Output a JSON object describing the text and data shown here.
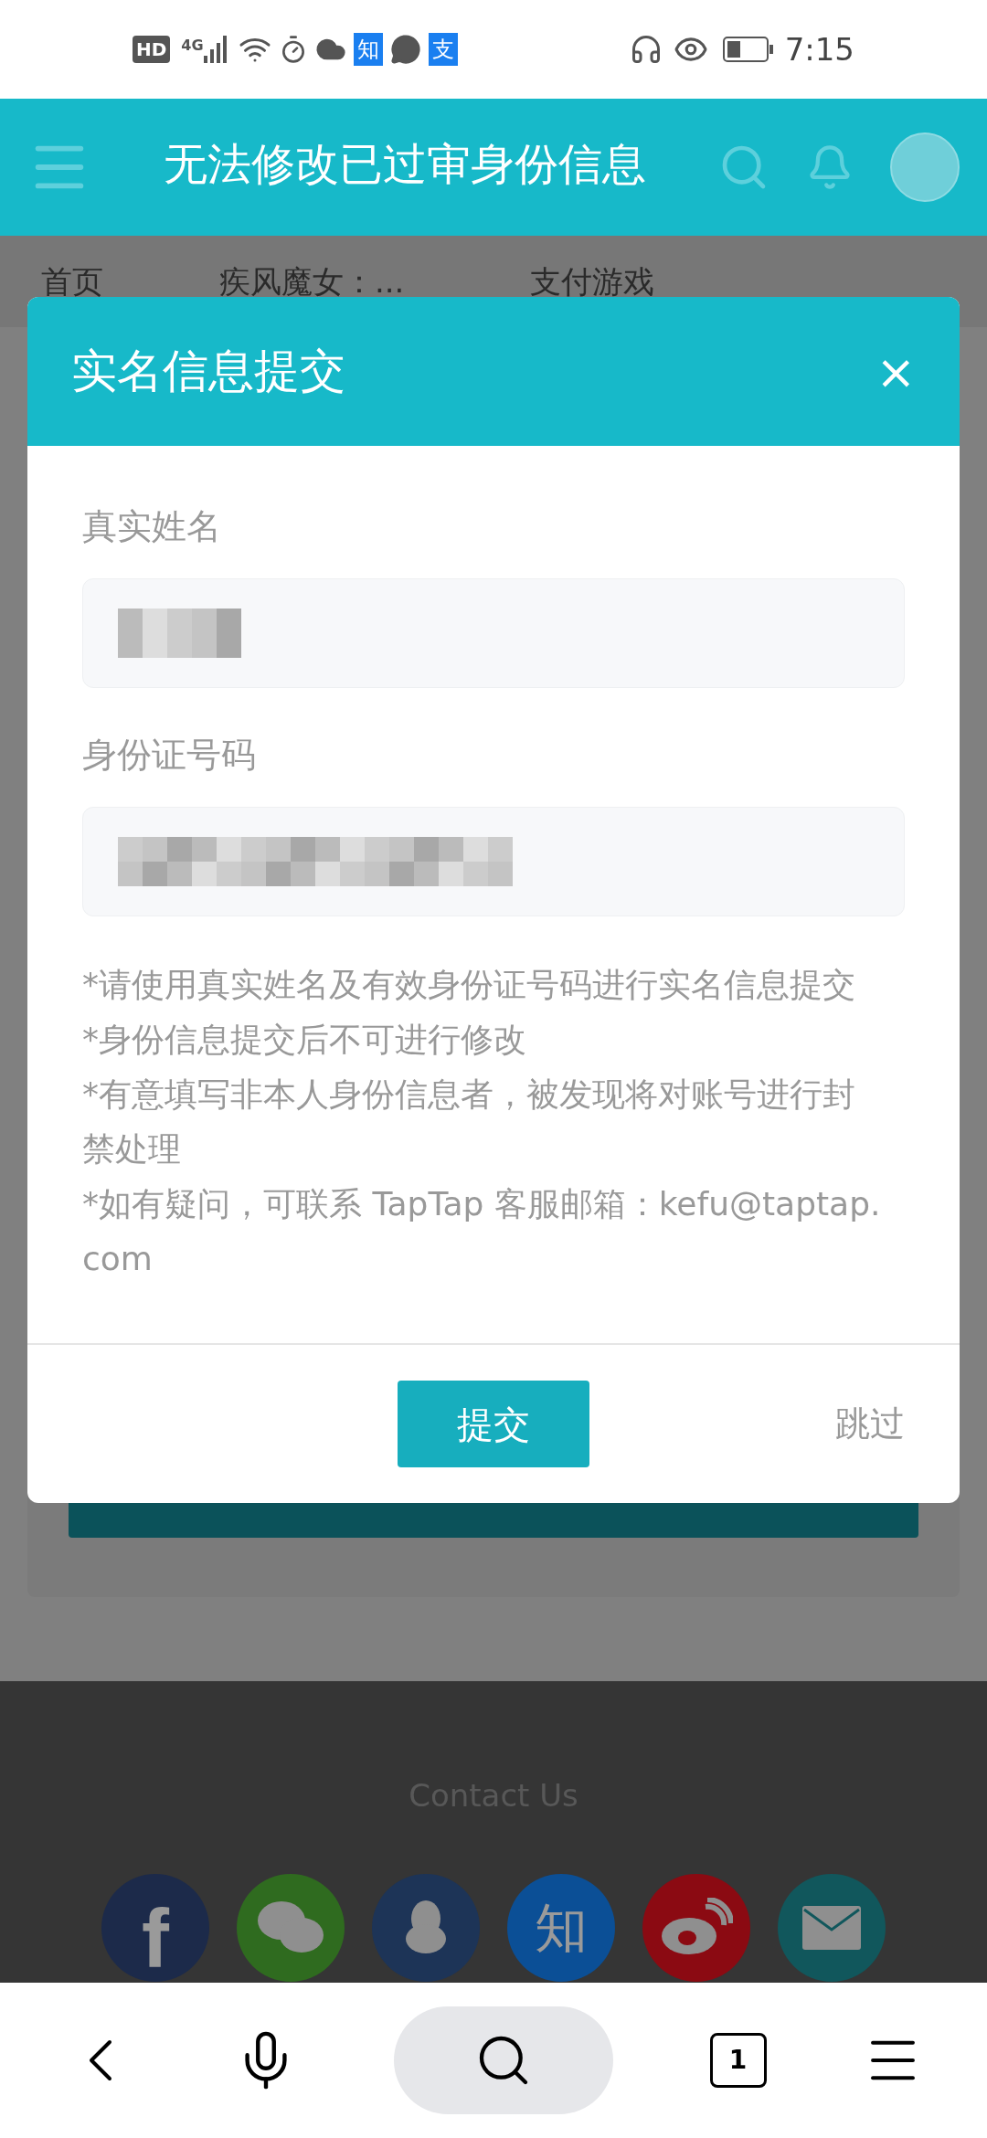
{
  "status_bar": {
    "badges": [
      "HD",
      "知",
      "支"
    ],
    "network": "4G",
    "time": "7:15"
  },
  "header": {
    "caption": "无法修改已过审身份信息"
  },
  "breadcrumb": [
    "首页",
    "疾风魔女：...",
    "支付游戏"
  ],
  "dialog": {
    "title": "实名信息提交",
    "close": "×",
    "fields": [
      {
        "label": "真实姓名",
        "kind": "redacted"
      },
      {
        "label": "身份证号码",
        "kind": "redacted"
      }
    ],
    "notes": [
      "*请使用真实姓名及有效身份证号码进行实名信息提交",
      "*身份信息提交后不可进行修改",
      "*有意填写非本人身份信息者，被发现将对账号进行封禁处理",
      "*如有疑问，可联系 TapTap 客服邮箱：kefu@taptap.com"
    ],
    "submit": "提交",
    "skip": "跳过"
  },
  "footer": {
    "title": "Contact Us",
    "social": [
      {
        "kind": "facebook",
        "label": "f",
        "color": "#1c2a4a"
      },
      {
        "kind": "wechat",
        "color": "#2f6b1f"
      },
      {
        "kind": "qq",
        "color": "#1d3457"
      },
      {
        "kind": "zhihu",
        "label": "知",
        "color": "#0b4f96"
      },
      {
        "kind": "weibo",
        "color": "#8b0a12"
      },
      {
        "kind": "mail",
        "color": "#11575c"
      }
    ]
  },
  "browser_bar": {
    "tab_count": "1"
  }
}
